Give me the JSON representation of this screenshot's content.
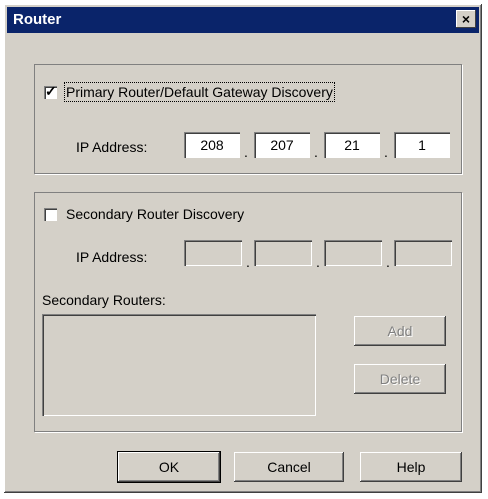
{
  "window": {
    "title": "Router",
    "close_glyph": "×"
  },
  "primary": {
    "checkbox_checked": true,
    "check_glyph": "✓",
    "label": "Primary Router/Default Gateway Discovery",
    "ip_label": "IP Address:",
    "ip": [
      "208",
      "207",
      "21",
      "1"
    ],
    "separator": "."
  },
  "secondary": {
    "checkbox_checked": false,
    "label": "Secondary Router Discovery",
    "ip_label": "IP Address:",
    "ip": [
      "",
      "",
      "",
      ""
    ],
    "separator": ".",
    "routers_label": "Secondary Routers:",
    "add_label": "Add",
    "delete_label": "Delete"
  },
  "buttons": {
    "ok": "OK",
    "cancel": "Cancel",
    "help": "Help"
  }
}
